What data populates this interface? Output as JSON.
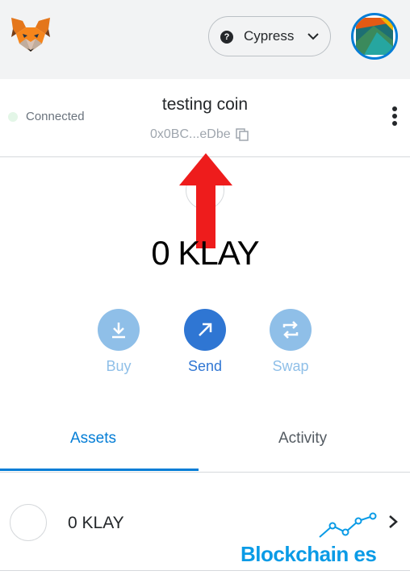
{
  "header": {
    "logo_icon": "metamask-fox-icon",
    "network": {
      "name": "Cypress",
      "help_icon": "question-icon",
      "chevron_icon": "chevron-down-icon"
    },
    "avatar_icon": "account-avatar-icon"
  },
  "account": {
    "connection_status": "Connected",
    "name": "testing coin",
    "address": "0x0BC...eDbe",
    "copy_icon": "copy-icon",
    "menu_icon": "kebab-menu-icon"
  },
  "overlay": {
    "arrow_icon": "red-arrow-up-icon"
  },
  "balance": {
    "primary": "0 KLAY"
  },
  "actions": [
    {
      "label": "Buy",
      "icon": "download-icon"
    },
    {
      "label": "Send",
      "icon": "arrow-up-right-icon"
    },
    {
      "label": "Swap",
      "icon": "swap-icon"
    }
  ],
  "tabs": [
    {
      "label": "Assets",
      "active": true
    },
    {
      "label": "Activity",
      "active": false
    }
  ],
  "assets": [
    {
      "label": "0 KLAY",
      "chevron_icon": "chevron-right-icon"
    }
  ],
  "watermark": {
    "text": "Blockchain es"
  },
  "colors": {
    "accent": "#037dd6",
    "connected": "#28a745",
    "send": "#2f76d3",
    "muted_action": "#8fbfe8",
    "arrow": "#ee1c1c",
    "watermark": "#0a9be6"
  }
}
